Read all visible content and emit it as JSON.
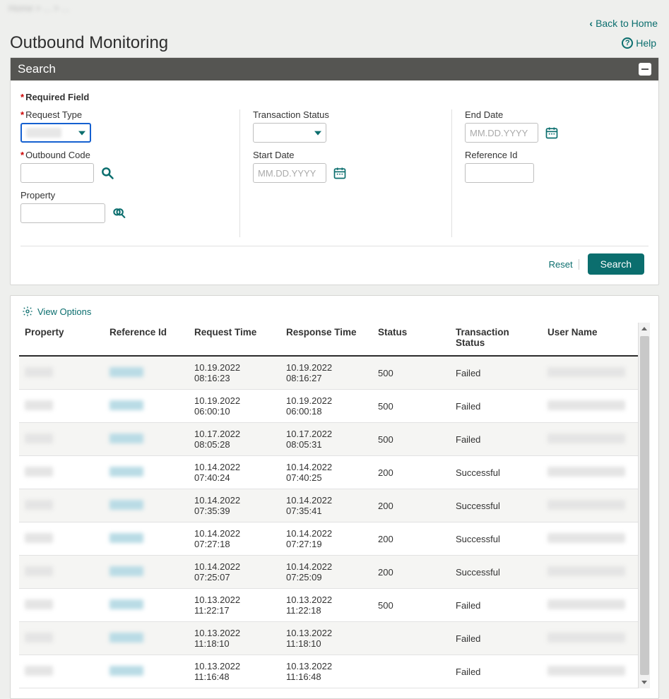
{
  "breadcrumb_placeholder": "Home  >  ...  >  ...",
  "top_links": {
    "back_to_home": "Back to Home",
    "help": "Help"
  },
  "page_title": "Outbound Monitoring",
  "search_panel": {
    "title": "Search",
    "required_note": "Required Field",
    "col1": {
      "request_type_label": "Request Type",
      "outbound_code_label": "Outbound Code",
      "property_label": "Property"
    },
    "col2": {
      "transaction_status_label": "Transaction Status",
      "start_date_label": "Start Date",
      "start_date_placeholder": "MM.DD.YYYY"
    },
    "col3": {
      "end_date_label": "End Date",
      "end_date_placeholder": "MM.DD.YYYY",
      "reference_id_label": "Reference Id"
    },
    "actions": {
      "reset": "Reset",
      "search": "Search"
    }
  },
  "results": {
    "view_options": "View Options",
    "headers": {
      "property": "Property",
      "reference_id": "Reference Id",
      "request_time": "Request Time",
      "response_time": "Response Time",
      "status": "Status",
      "transaction_status": "Transaction Status",
      "user_name": "User Name"
    },
    "rows": [
      {
        "request_time": "10.19.2022 08:16:23",
        "response_time": "10.19.2022 08:16:27",
        "status": "500",
        "transaction_status": "Failed"
      },
      {
        "request_time": "10.19.2022 06:00:10",
        "response_time": "10.19.2022 06:00:18",
        "status": "500",
        "transaction_status": "Failed"
      },
      {
        "request_time": "10.17.2022 08:05:28",
        "response_time": "10.17.2022 08:05:31",
        "status": "500",
        "transaction_status": "Failed"
      },
      {
        "request_time": "10.14.2022 07:40:24",
        "response_time": "10.14.2022 07:40:25",
        "status": "200",
        "transaction_status": "Successful"
      },
      {
        "request_time": "10.14.2022 07:35:39",
        "response_time": "10.14.2022 07:35:41",
        "status": "200",
        "transaction_status": "Successful"
      },
      {
        "request_time": "10.14.2022 07:27:18",
        "response_time": "10.14.2022 07:27:19",
        "status": "200",
        "transaction_status": "Successful"
      },
      {
        "request_time": "10.14.2022 07:25:07",
        "response_time": "10.14.2022 07:25:09",
        "status": "200",
        "transaction_status": "Successful"
      },
      {
        "request_time": "10.13.2022 11:22:17",
        "response_time": "10.13.2022 11:22:18",
        "status": "500",
        "transaction_status": "Failed"
      },
      {
        "request_time": "10.13.2022 11:18:10",
        "response_time": "10.13.2022 11:18:10",
        "status": "",
        "transaction_status": "Failed"
      },
      {
        "request_time": "10.13.2022 11:16:48",
        "response_time": "10.13.2022 11:16:48",
        "status": "",
        "transaction_status": "Failed"
      }
    ]
  },
  "colors": {
    "accent": "#0b6e6e",
    "panel_header": "#555552",
    "focus_border": "#1560d0"
  }
}
